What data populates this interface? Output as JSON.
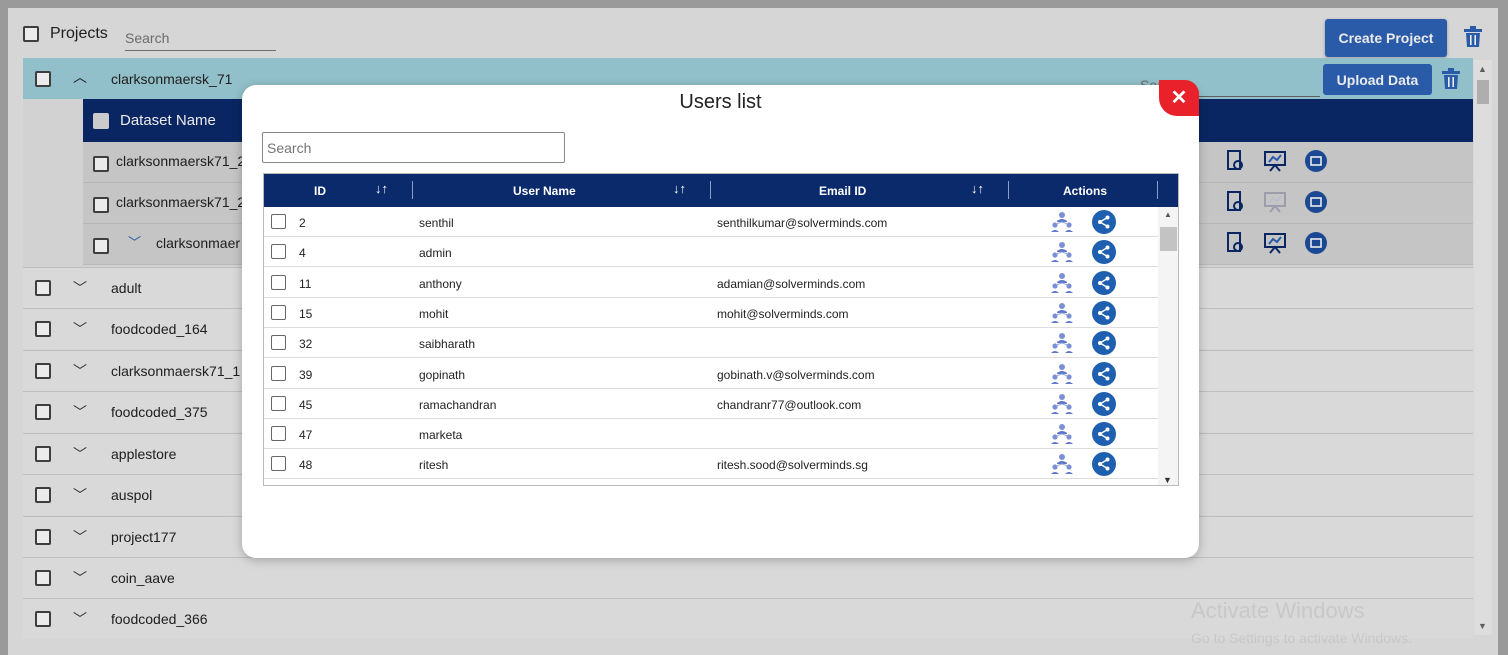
{
  "header": {
    "projects_label": "Projects",
    "search_placeholder": "Search",
    "create_button": "Create Project"
  },
  "expanded_project": {
    "name": "clarksonmaersk_71",
    "search_placeholder": "Search",
    "upload_button": "Upload Data",
    "dataset_header": "Dataset Name",
    "datasets": [
      "clarksonmaersk71_2",
      "clarksonmaersk71_2",
      "clarksonmaer"
    ]
  },
  "projects": [
    "adult",
    "foodcoded_164",
    "clarksonmaersk71_1",
    "foodcoded_375",
    "applestore",
    "auspol",
    "project177",
    "coin_aave",
    "foodcoded_366"
  ],
  "watermark": {
    "line1": "Activate Windows",
    "line2": "Go to Settings to activate Windows."
  },
  "modal": {
    "title": "Users list",
    "close_label": "✕",
    "search_placeholder": "Search",
    "columns": [
      "ID",
      "User Name",
      "Email ID",
      "Actions"
    ],
    "rows": [
      {
        "id": "2",
        "user": "senthil",
        "email": "senthilkumar@solverminds.com"
      },
      {
        "id": "4",
        "user": "admin",
        "email": ""
      },
      {
        "id": "11",
        "user": "anthony",
        "email": "adamian@solverminds.com"
      },
      {
        "id": "15",
        "user": "mohit",
        "email": "mohit@solverminds.com"
      },
      {
        "id": "32",
        "user": "saibharath",
        "email": ""
      },
      {
        "id": "39",
        "user": "gopinath",
        "email": "gobinath.v@solverminds.com"
      },
      {
        "id": "45",
        "user": "ramachandran",
        "email": "chandranr77@outlook.com"
      },
      {
        "id": "47",
        "user": "marketa",
        "email": ""
      },
      {
        "id": "48",
        "user": "ritesh",
        "email": "ritesh.sood@solverminds.sg"
      }
    ]
  },
  "colors": {
    "primary": "#2e63b8",
    "header_navy": "#0b2a6b",
    "close_red": "#e8212a",
    "expanded_teal": "#9fd1dc"
  }
}
